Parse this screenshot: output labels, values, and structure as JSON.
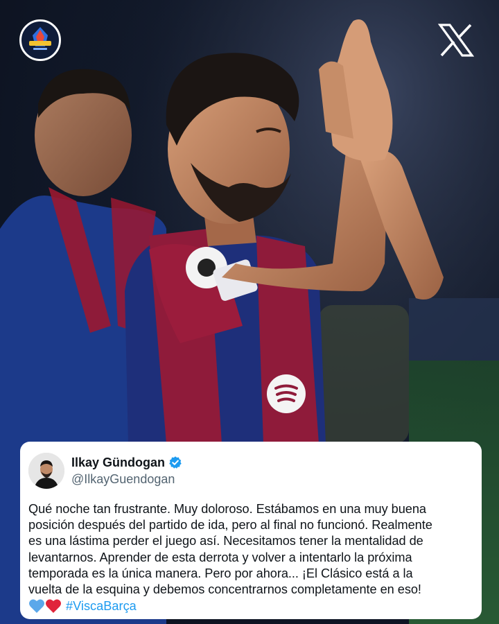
{
  "brand": {
    "logo_icon": "channel-crest-icon"
  },
  "platform": {
    "icon": "x-logo-icon"
  },
  "tweet": {
    "display_name": "Ilkay Gündogan",
    "handle": "@IlkayGuendogan",
    "verified_color": "#1d9bf0",
    "text": "Qué noche tan frustrante. Muy doloroso. Estábamos en una muy buena\nposición después del partido de ida, pero al final no funcionó. Realmente\nes una lástima perder el juego así. Necesitamos tener la mentalidad de\nlevantarnos. Aprender de esta derrota y volver a intentarlo la próxima\ntemporada es la única manera. Pero por ahora... ¡El Clásico está a la\nvuelta de la esquina y debemos concentrarnos completamente en eso!",
    "hashtag": "#ViscaBarça",
    "emojis": [
      "blue-heart-icon",
      "red-heart-icon"
    ],
    "hashtag_color": "#1d9bf0"
  }
}
